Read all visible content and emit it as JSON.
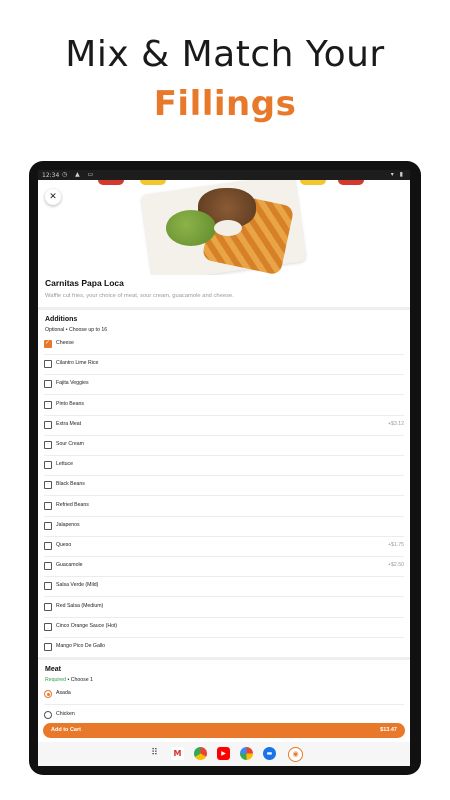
{
  "promo": {
    "line1": "Mix & Match Your",
    "line2": "Fillings"
  },
  "statusbar": {
    "time": "12:34"
  },
  "item": {
    "title": "Carnitas Papa Loca",
    "description": "Waffle cut fries, your choice of meat, sour cream, guacamole and cheese."
  },
  "additions": {
    "title": "Additions",
    "subtitle": "Optional • Choose up to 16",
    "options": [
      {
        "label": "Cheese",
        "price": "",
        "checked": true
      },
      {
        "label": "Cilantro Lime Rice",
        "price": "",
        "checked": false
      },
      {
        "label": "Fajita Veggies",
        "price": "",
        "checked": false
      },
      {
        "label": "Pinto Beans",
        "price": "",
        "checked": false
      },
      {
        "label": "Extra Meat",
        "price": "+$3.12",
        "checked": false
      },
      {
        "label": "Sour Cream",
        "price": "",
        "checked": false
      },
      {
        "label": "Lettuce",
        "price": "",
        "checked": false
      },
      {
        "label": "Black Beans",
        "price": "",
        "checked": false
      },
      {
        "label": "Refried Beans",
        "price": "",
        "checked": false
      },
      {
        "label": "Jalapenos",
        "price": "",
        "checked": false
      },
      {
        "label": "Queso",
        "price": "+$1.75",
        "checked": false
      },
      {
        "label": "Guacamole",
        "price": "+$2.50",
        "checked": false
      },
      {
        "label": "Salsa Verde (Mild)",
        "price": "",
        "checked": false
      },
      {
        "label": "Red Salsa (Medium)",
        "price": "",
        "checked": false
      },
      {
        "label": "Cinco Orange Sauce (Hot)",
        "price": "",
        "checked": false
      },
      {
        "label": "Mango Pico De Gallo",
        "price": "",
        "checked": false
      }
    ]
  },
  "meat": {
    "title": "Meat",
    "required": "Required",
    "subtitle_rest": " • Choose 1",
    "options": [
      {
        "label": "Asada",
        "selected": true
      },
      {
        "label": "Chicken",
        "selected": false
      }
    ]
  },
  "cart": {
    "label": "Add to Cart",
    "total": "$13.47"
  },
  "dock": [
    "apps-icon",
    "gmail-icon",
    "chrome-icon",
    "youtube-icon",
    "photos-icon",
    "messages-icon",
    "app-icon"
  ],
  "colors": {
    "accent": "#e8782a",
    "required": "#2e9e3f"
  }
}
